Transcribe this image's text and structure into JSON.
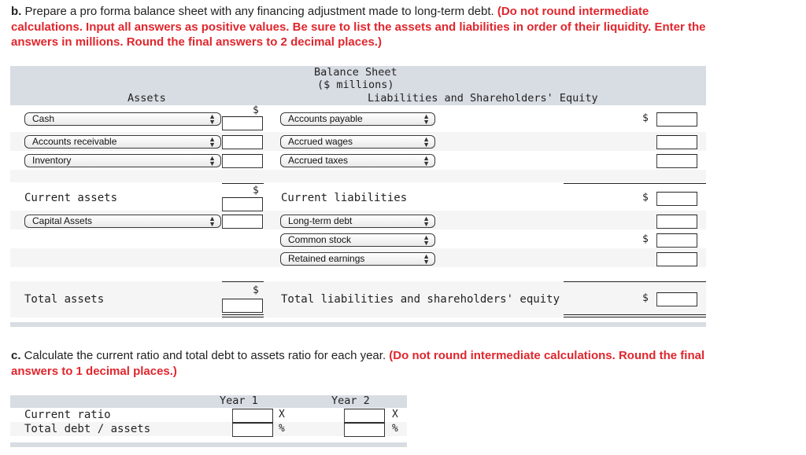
{
  "part_b": {
    "lead": "b.",
    "text": " Prepare a pro forma balance sheet with any financing adjustment made to long-term debt. ",
    "red_line1": "(Do not round intermediate",
    "red_line2": "calculations. Input all answers as positive values. Be sure to list the assets and liabilities in order of their liquidity. Enter the",
    "red_line3": "answers in millions. Round the final answers to 2 decimal places.)"
  },
  "balance_sheet": {
    "title": "Balance Sheet",
    "subtitle": "($ millions)",
    "assets_header": "Assets",
    "liabilities_header": "Liabilities and Shareholders' Equity",
    "currency": "$",
    "asset_rows": [
      {
        "selected": "Cash",
        "value": ""
      },
      {
        "selected": "Accounts receivable",
        "value": ""
      },
      {
        "selected": "Inventory",
        "value": ""
      }
    ],
    "current_assets_label": "Current assets",
    "current_assets_value": "",
    "capital_row": {
      "selected": "Capital Assets",
      "value": ""
    },
    "total_assets_label": "Total assets",
    "total_assets_value": "",
    "liability_rows": [
      {
        "selected": "Accounts payable",
        "value": ""
      },
      {
        "selected": "Accrued wages",
        "value": ""
      },
      {
        "selected": "Accrued taxes",
        "value": ""
      }
    ],
    "current_liabilities_label": "Current liabilities",
    "current_liabilities_value": "",
    "long_term_rows": [
      {
        "selected": "Long-term debt",
        "value": ""
      },
      {
        "selected": "Common stock",
        "value": ""
      },
      {
        "selected": "Retained earnings",
        "value": ""
      }
    ],
    "total_le_label": "Total liabilities and shareholders' equity",
    "total_le_value": ""
  },
  "part_c": {
    "lead": "c.",
    "text": " Calculate the current ratio and total debt to assets ratio for each year. ",
    "red_line1": "(Do not round intermediate calculations. Round the final",
    "red_line2": "answers to 1 decimal places.)"
  },
  "ratios": {
    "columns": [
      "Year 1",
      "Year 2"
    ],
    "rows": [
      {
        "label": "Current ratio",
        "unit": "X",
        "values": [
          "",
          ""
        ]
      },
      {
        "label": "Total debt / assets",
        "unit": "%",
        "values": [
          "",
          ""
        ]
      }
    ]
  },
  "icons": {
    "select_arrow": "▲▼"
  }
}
